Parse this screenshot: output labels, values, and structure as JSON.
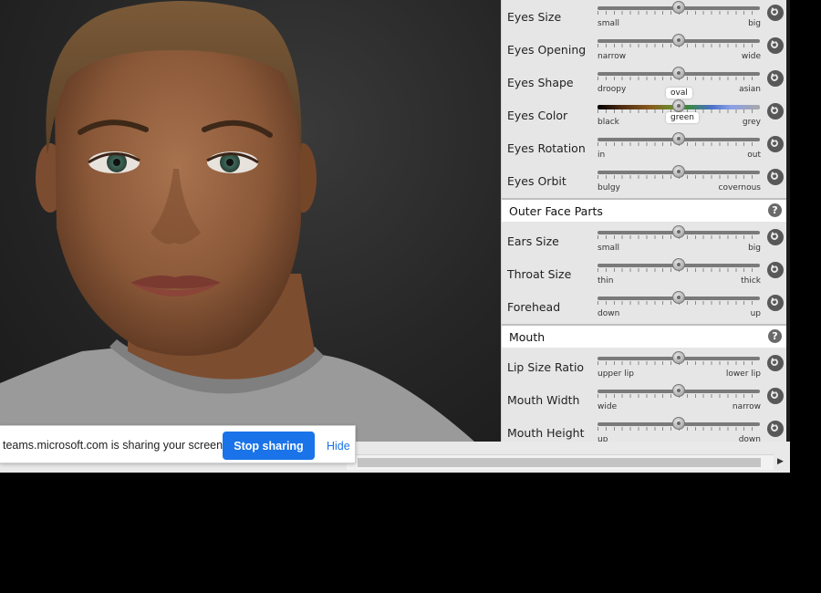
{
  "colors": {
    "share_button": "#1a73e8",
    "panel_bg": "#e6e6e6",
    "section_header_bg": "#ffffff"
  },
  "panel": {
    "eyes_rows": [
      {
        "label": "Eyes Size",
        "left": "small",
        "right": "big",
        "value": 0.5
      },
      {
        "label": "Eyes Opening",
        "left": "narrow",
        "right": "wide",
        "value": 0.5
      },
      {
        "label": "Eyes Shape",
        "left": "droopy",
        "right": "asian",
        "value": 0.5,
        "tooltip": "oval"
      },
      {
        "label": "Eyes Color",
        "left": "black",
        "right": "grey",
        "value": 0.5,
        "tooltip": "green"
      },
      {
        "label": "Eyes Rotation",
        "left": "in",
        "right": "out",
        "value": 0.5
      },
      {
        "label": "Eyes Orbit",
        "left": "bulgy",
        "right": "covernous",
        "value": 0.5
      }
    ],
    "outer_face": {
      "title": "Outer Face Parts",
      "rows": [
        {
          "label": "Ears Size",
          "left": "small",
          "right": "big",
          "value": 0.5
        },
        {
          "label": "Throat Size",
          "left": "thin",
          "right": "thick",
          "value": 0.5
        },
        {
          "label": "Forehead",
          "left": "down",
          "right": "up",
          "value": 0.5
        }
      ]
    },
    "mouth": {
      "title": "Mouth",
      "rows": [
        {
          "label": "Lip Size Ratio",
          "left": "upper lip",
          "right": "lower lip",
          "value": 0.5
        },
        {
          "label": "Mouth Width",
          "left": "wide",
          "right": "narrow",
          "value": 0.5
        },
        {
          "label": "Mouth Height",
          "left": "up",
          "right": "down",
          "value": 0.5
        }
      ]
    }
  },
  "share_bar": {
    "message": "teams.microsoft.com is sharing your screen.",
    "stop_label": "Stop sharing",
    "hide_label": "Hide"
  },
  "scrollbar": {
    "arrow": "▶"
  }
}
